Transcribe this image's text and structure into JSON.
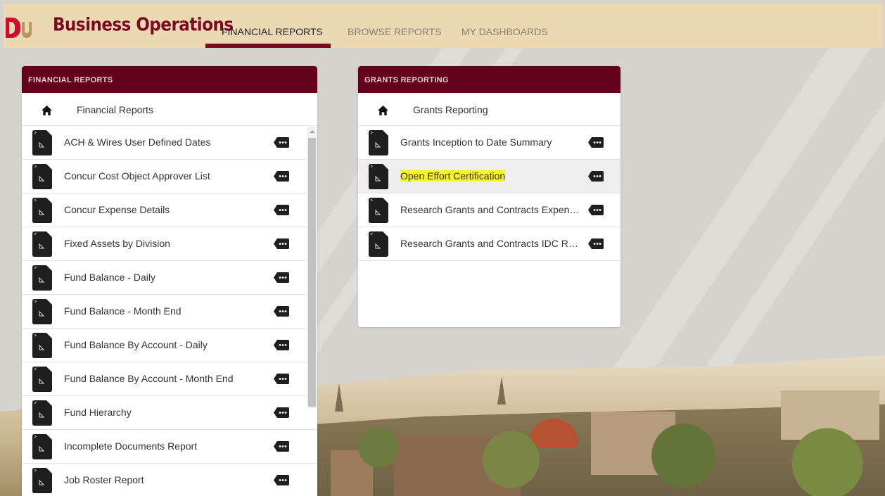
{
  "header": {
    "brand": "Business Operations",
    "tabs": [
      {
        "label": "FINANCIAL REPORTS",
        "active": true
      },
      {
        "label": "BROWSE REPORTS",
        "active": false
      },
      {
        "label": "MY DASHBOARDS",
        "active": false
      }
    ]
  },
  "colors": {
    "header_bg": "#ecd8b3",
    "brand": "#7b0a21",
    "panel_header": "#65001c",
    "highlight": "#f6f51f"
  },
  "financial_panel": {
    "title": "FINANCIAL REPORTS",
    "home_label": "Financial Reports",
    "items": [
      "ACH & Wires User Defined Dates",
      "Concur Cost Object Approver List",
      "Concur Expense Details",
      "Fixed Assets by Division",
      "Fund Balance - Daily",
      "Fund Balance - Month End",
      "Fund Balance By Account - Daily",
      "Fund Balance By Account - Month End",
      "Fund Hierarchy",
      "Incomplete Documents Report",
      "Job Roster Report"
    ]
  },
  "grants_panel": {
    "title": "GRANTS REPORTING",
    "home_label": "Grants Reporting",
    "items": [
      "Grants Inception to Date Summary",
      "Open Effort Certification",
      "Research Grants and Contracts Expenses",
      "Research Grants and Contracts IDC Report"
    ],
    "selected_index": 1
  },
  "icons": {
    "home": "home-icon",
    "report": "report-document-icon",
    "more": "more-options-icon"
  }
}
